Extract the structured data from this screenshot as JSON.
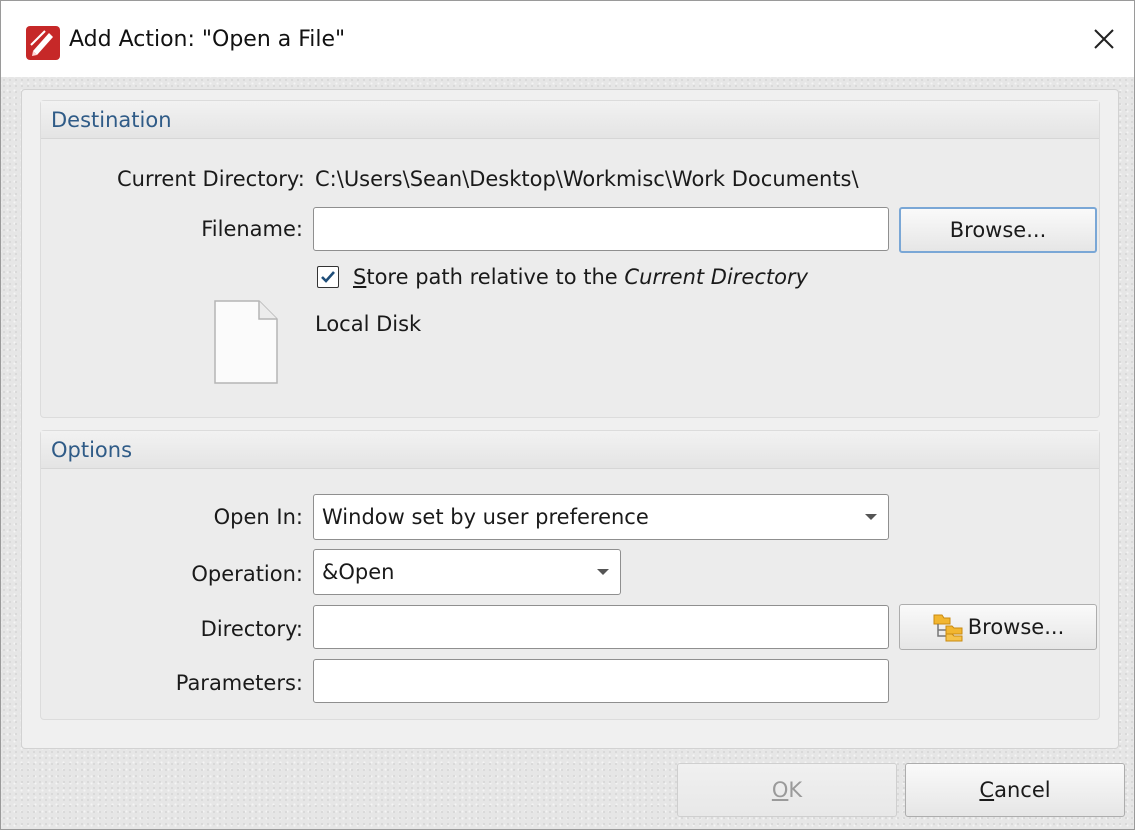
{
  "window": {
    "title": "Add Action: \"Open a File\"",
    "app_icon": "pdf-editor-app-icon",
    "close_icon": "close-icon"
  },
  "destination": {
    "header": "Destination",
    "current_directory_label": "Current Directory:",
    "current_directory_value": "C:\\Users\\Sean\\Desktop\\Workmisc\\Work Documents\\",
    "filename_label": "Filename:",
    "filename_value": "",
    "browse_label": "Browse...",
    "store_relative": {
      "checked": true,
      "label_mnemonic": "S",
      "label_rest": "tore path relative to the ",
      "label_italic": "Current Directory"
    },
    "file_icon": "document-icon",
    "file_location": "Local Disk"
  },
  "options": {
    "header": "Options",
    "open_in_label": "Open In:",
    "open_in_value": "Window set by user preference",
    "operation_label": "Operation:",
    "operation_value": "&Open",
    "directory_label": "Directory:",
    "directory_value": "",
    "directory_browse_label": "Browse...",
    "directory_browse_icon": "folder-tree-icon",
    "parameters_label": "Parameters:",
    "parameters_value": ""
  },
  "footer": {
    "ok_mnemonic": "O",
    "ok_rest": "K",
    "cancel_mnemonic": "C",
    "cancel_rest": "ancel"
  }
}
